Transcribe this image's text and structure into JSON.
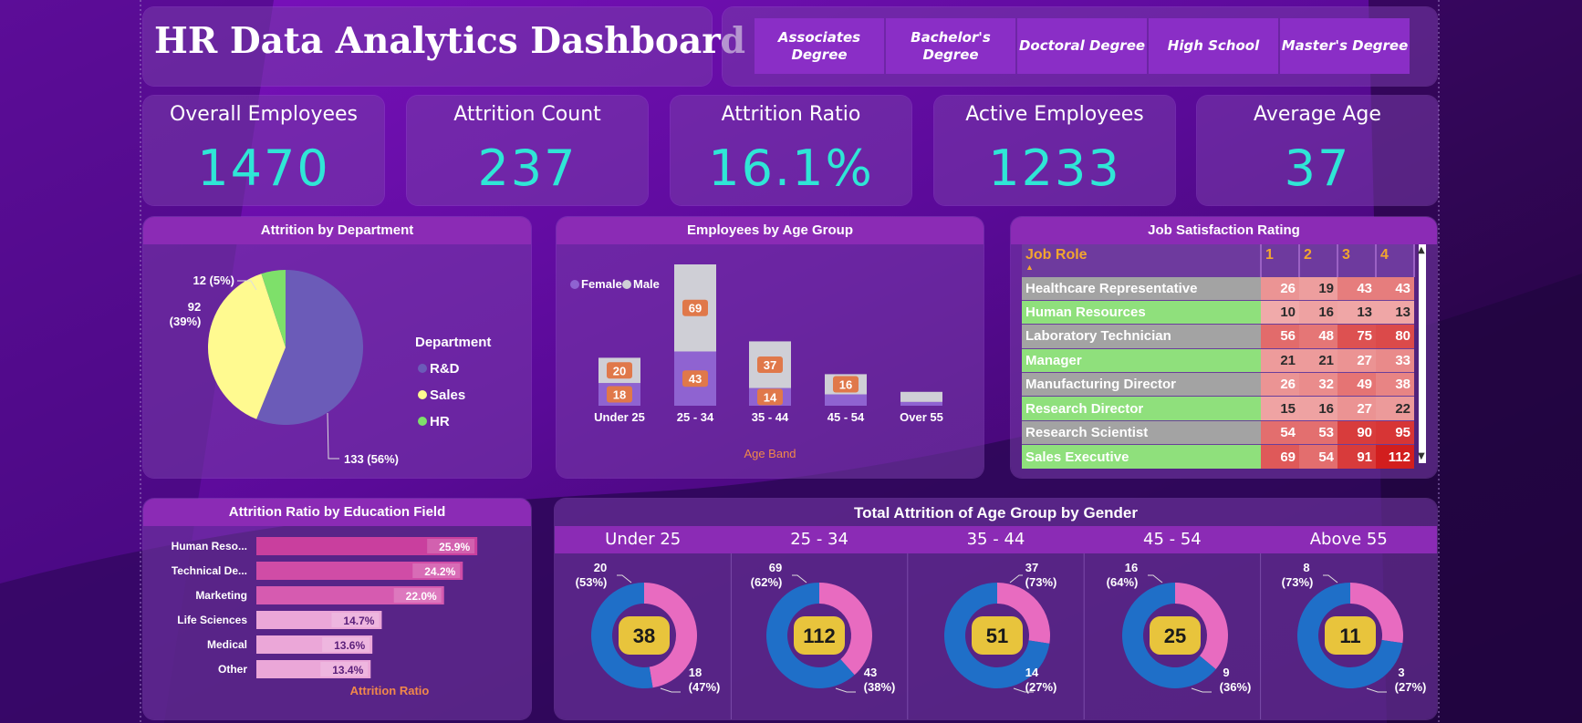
{
  "title": "HR Data Analytics Dashboard",
  "slicer": {
    "options": [
      "Associates Degree",
      "Bachelor's Degree",
      "Doctoral Degree",
      "High School",
      "Master's Degree"
    ]
  },
  "kpis": [
    {
      "label": "Overall Employees",
      "value": "1470"
    },
    {
      "label": "Attrition Count",
      "value": "237"
    },
    {
      "label": "Attrition Ratio",
      "value": "16.1%"
    },
    {
      "label": "Active Employees",
      "value": "1233"
    },
    {
      "label": "Average Age",
      "value": "37"
    }
  ],
  "colors": {
    "kpi_value": "#2fe6d6",
    "rd": "#6b5bb8",
    "sales": "#fffa90",
    "hr": "#7ee06a",
    "female": "#8f63d1",
    "male": "#cfcfd6",
    "data_label_bg": "#e0784a",
    "donut_blue": "#1f6fc8",
    "donut_pink": "#e86bc0",
    "center_badge": "#e8c43c"
  },
  "chart_data": [
    {
      "type": "pie",
      "title": "Attrition by Department",
      "legend_title": "Department",
      "legend_position": "right",
      "categories": [
        "R&D",
        "Sales",
        "HR"
      ],
      "values": [
        133,
        92,
        12
      ],
      "labels": [
        "133 (56%)",
        "92 (39%)",
        "12 (5%)"
      ]
    },
    {
      "type": "bar",
      "stacked": true,
      "title": "Employees by Age Group",
      "xlabel": "Age Band",
      "legend_position": "top-left",
      "categories": [
        "Under 25",
        "25 - 34",
        "35 - 44",
        "45 - 54",
        "Over 55"
      ],
      "series": [
        {
          "name": "Female",
          "values": [
            18,
            43,
            14,
            9,
            3
          ]
        },
        {
          "name": "Male",
          "values": [
            20,
            69,
            37,
            16,
            8
          ]
        }
      ],
      "data_labels": {
        "Female": [
          "18",
          "43",
          "14",
          "",
          ""
        ],
        "Male": [
          "20",
          "69",
          "37",
          "16",
          ""
        ]
      }
    },
    {
      "type": "table",
      "title": "Job Satisfaction Rating",
      "columns": [
        "Job Role",
        "1",
        "2",
        "3",
        "4"
      ],
      "rows": [
        [
          "Healthcare Representative",
          26,
          19,
          43,
          43
        ],
        [
          "Human Resources",
          10,
          16,
          13,
          13
        ],
        [
          "Laboratory Technician",
          56,
          48,
          75,
          80
        ],
        [
          "Manager",
          21,
          21,
          27,
          33
        ],
        [
          "Manufacturing Director",
          26,
          32,
          49,
          38
        ],
        [
          "Research Director",
          15,
          16,
          27,
          22
        ],
        [
          "Research Scientist",
          54,
          53,
          90,
          95
        ],
        [
          "Sales Executive",
          69,
          54,
          91,
          112
        ]
      ]
    },
    {
      "type": "bar",
      "orientation": "horizontal",
      "title": "Attrition Ratio by Education Field",
      "xlabel": "Attrition Ratio",
      "categories": [
        "Human Reso...",
        "Technical De...",
        "Marketing",
        "Life Sciences",
        "Medical",
        "Other"
      ],
      "values": [
        25.9,
        24.2,
        22.0,
        14.7,
        13.6,
        13.4
      ],
      "labels": [
        "25.9%",
        "24.2%",
        "22.0%",
        "14.7%",
        "13.6%",
        "13.4%"
      ]
    },
    {
      "type": "pie",
      "title": "Total Attrition of Age Group by Gender",
      "groups": [
        {
          "name": "Under 25",
          "total": "38",
          "female": 18,
          "male": 20,
          "female_label": "18",
          "female_pct": "(47%)",
          "male_label": "20",
          "male_pct": "(53%)"
        },
        {
          "name": "25 - 34",
          "total": "112",
          "female": 43,
          "male": 69,
          "female_label": "43",
          "female_pct": "(38%)",
          "male_label": "69",
          "male_pct": "(62%)"
        },
        {
          "name": "35 - 44",
          "total": "51",
          "female": 14,
          "male": 37,
          "female_label": "14",
          "female_pct": "(27%)",
          "male_label": "37",
          "male_pct": "(73%)"
        },
        {
          "name": "45 - 54",
          "total": "25",
          "female": 9,
          "male": 16,
          "female_label": "9",
          "female_pct": "(36%)",
          "male_label": "16",
          "male_pct": "(64%)"
        },
        {
          "name": "Above 55",
          "total": "11",
          "female": 3,
          "male": 8,
          "female_label": "3",
          "female_pct": "(27%)",
          "male_label": "8",
          "male_pct": "(73%)"
        }
      ]
    }
  ]
}
